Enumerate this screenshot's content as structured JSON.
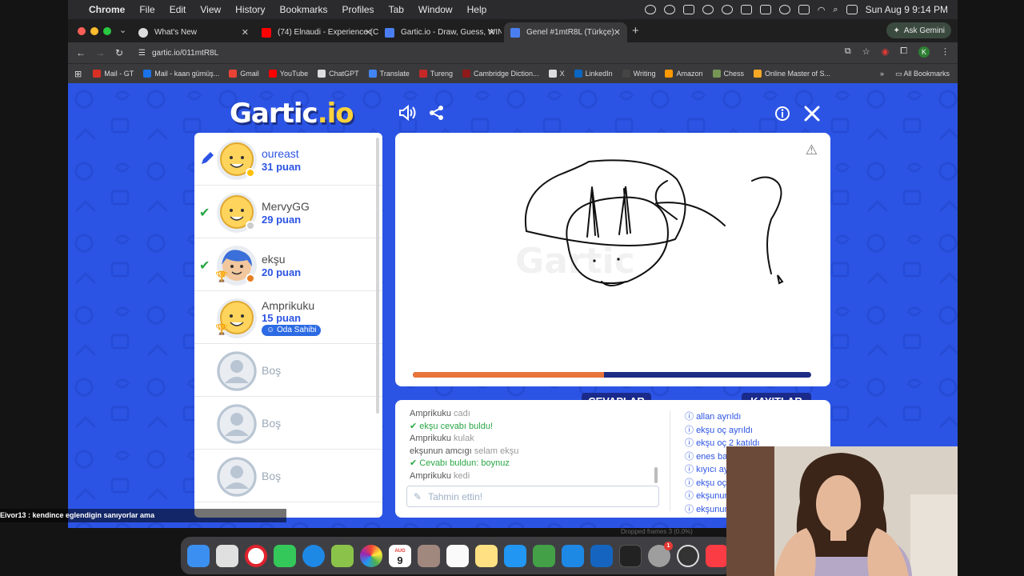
{
  "menubar": {
    "app": "Chrome",
    "items": [
      "File",
      "Edit",
      "View",
      "History",
      "Bookmarks",
      "Profiles",
      "Tab",
      "Window",
      "Help"
    ],
    "clock": "Sun Aug 9  9:14 PM"
  },
  "tabs": [
    {
      "label": "What's New"
    },
    {
      "label": "(74) Elnaudi - Experience (C"
    },
    {
      "label": "Gartic.io - Draw, Guess, WIN"
    },
    {
      "label": "Genel #1mtR8L (Türkçe)"
    }
  ],
  "gemini_label": "Ask Gemini",
  "address": "gartic.io/011mtR8L",
  "avatar_initial": "K",
  "bookmarks": [
    {
      "label": "Mail - GT",
      "color": "#d93025"
    },
    {
      "label": "Mail - kaan gümüş...",
      "color": "#1a73e8"
    },
    {
      "label": "Gmail",
      "color": "#ea4335"
    },
    {
      "label": "YouTube",
      "color": "#ff0000"
    },
    {
      "label": "ChatGPT",
      "color": "#dddddd"
    },
    {
      "label": "Translate",
      "color": "#4285f4"
    },
    {
      "label": "Tureng",
      "color": "#c62828"
    },
    {
      "label": "Cambridge Diction...",
      "color": "#8e1a1a"
    },
    {
      "label": "X",
      "color": "#dddddd"
    },
    {
      "label": "LinkedIn",
      "color": "#0a66c2"
    },
    {
      "label": "Writing",
      "color": "#444444"
    },
    {
      "label": "Amazon",
      "color": "#ff9900"
    },
    {
      "label": "Chess",
      "color": "#769656"
    },
    {
      "label": "Online Master of S...",
      "color": "#f9a825"
    }
  ],
  "all_bookmarks": "All Bookmarks",
  "game": {
    "logo_main": "Gartic",
    "logo_tld": ".io",
    "players": [
      {
        "name": "oureast",
        "score": "31 puan",
        "status": "drawing",
        "dot": "#ffc107"
      },
      {
        "name": "MervyGG",
        "score": "29 puan",
        "status": "guessed",
        "dot": "#cccccc"
      },
      {
        "name": "ekşu",
        "score": "20 puan",
        "status": "guessed",
        "dot": "#e67e22"
      },
      {
        "name": "Amprikuku",
        "score": "15 puan",
        "badge": "Oda Sahibi"
      }
    ],
    "empty_label": "Boş",
    "progress": 0.48,
    "answers_tab": "CEVAPLAR",
    "logs_tab": "KAYITLAR",
    "chat": [
      {
        "user": "Amprikuku",
        "text": "cadı",
        "kind": "msg"
      },
      {
        "text": "ekşu cevabı buldu!",
        "kind": "ok"
      },
      {
        "user": "Amprikuku",
        "text": "kulak",
        "kind": "msg"
      },
      {
        "user": "ekşunun amcıgı",
        "text": "selam ekşu",
        "kind": "msg"
      },
      {
        "text": "Cevabı buldun:",
        "answer": "boynuz",
        "kind": "ok2"
      },
      {
        "user": "Amprikuku",
        "text": "kedi",
        "kind": "msg"
      }
    ],
    "guess_placeholder": "Tahmin ettin!",
    "logs": [
      "allan ayrıldı",
      "ekşu oç ayrıldı",
      "ekşu oç 2 katıldı",
      "enes ba",
      "kıyıcı ay",
      "ekşu oç",
      "ekşunun",
      "ekşunun"
    ]
  },
  "stream_chat": "Eivor13 : kendince eglendigin sanıyorlar ama",
  "dock_date": "9",
  "dock_month": "AUG",
  "dock_badge": "1",
  "tags": [
    "Dropped frames 3 (0.0%)"
  ]
}
